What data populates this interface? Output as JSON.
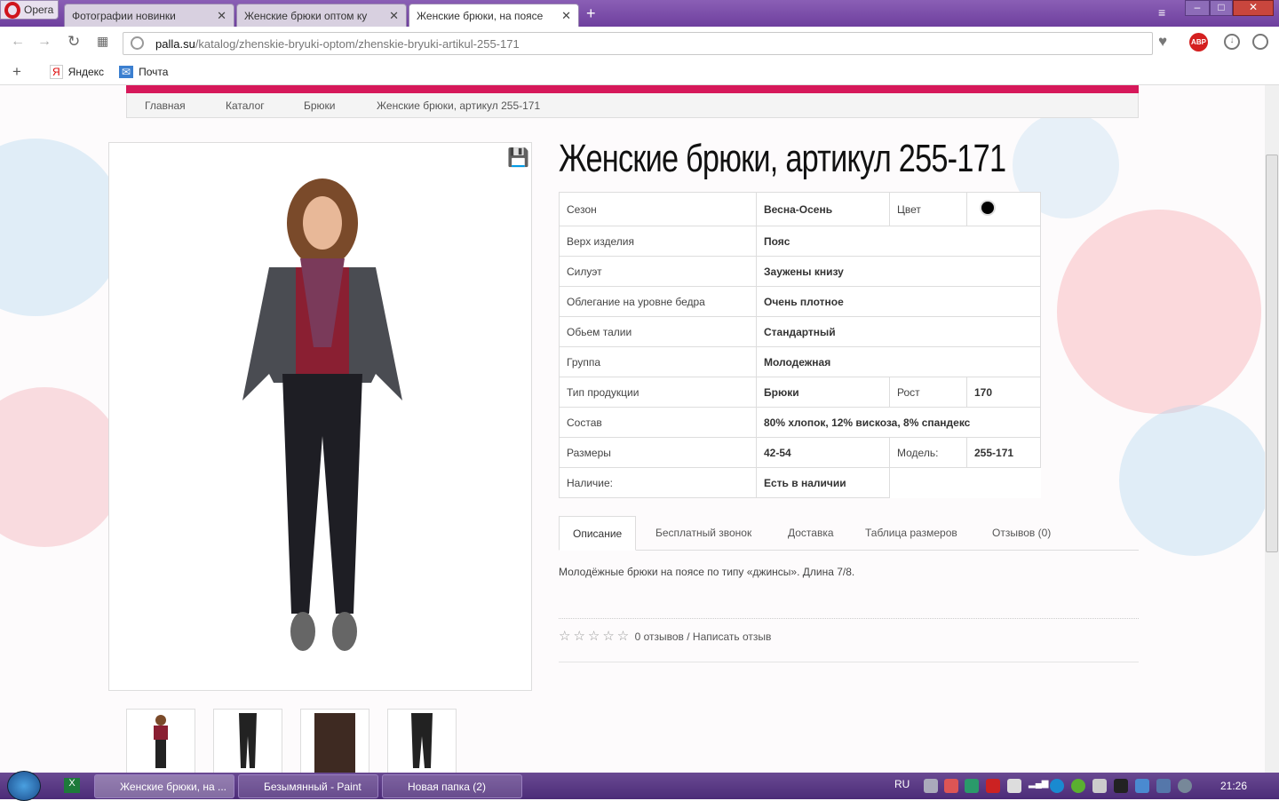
{
  "browser": {
    "opera_label": "Opera",
    "tabs": [
      {
        "label": "Фотографии новинки"
      },
      {
        "label": "Женские брюки оптом ку"
      },
      {
        "label": "Женские брюки, на поясе"
      }
    ],
    "url_host": "palla.su",
    "url_path": "/katalog/zhenskie-bryuki-optom/zhenskie-bryuki-artikul-255-171",
    "bookmarks": [
      {
        "label": "Яндекс"
      },
      {
        "label": "Почта"
      }
    ]
  },
  "breadcrumb": [
    "Главная",
    "Каталог",
    "Брюки",
    "Женские брюки, артикул 255-171"
  ],
  "product": {
    "title": "Женские брюки, артикул 255-171",
    "specs": [
      {
        "label": "Сезон",
        "value": "Весна-Осень",
        "label2": "Цвет",
        "color": "#000000"
      },
      {
        "label": "Верх изделия",
        "value": "Пояс"
      },
      {
        "label": "Силуэт",
        "value": "Заужены книзу"
      },
      {
        "label": "Облегание на уровне бедра",
        "value": "Очень плотное"
      },
      {
        "label": "Обьем талии",
        "value": "Стандартный"
      },
      {
        "label": "Группа",
        "value": "Молодежная"
      },
      {
        "label": "Тип продукции",
        "value": "Брюки",
        "label2": "Рост",
        "value2": "170"
      },
      {
        "label": "Состав",
        "value": "80% хлопок, 12% вискоза, 8% спандекс"
      },
      {
        "label": "Размеры",
        "value": "42-54",
        "label2": "Модель:",
        "value2": "255-171"
      },
      {
        "label": "Наличие:",
        "value": "Есть в наличии"
      }
    ],
    "tabs": [
      "Описание",
      "Бесплатный звонок",
      "Доставка",
      "Таблица размеров",
      "Отзывов (0)"
    ],
    "description": "Молодёжные брюки на поясе по типу «джинсы». Длина 7/8.",
    "rating": 0,
    "reviews_text": "0 отзывов / Написать отзыв"
  },
  "taskbar": {
    "tasks": [
      "Женские брюки, на ...",
      "Безымянный - Paint",
      "Новая папка (2)"
    ],
    "lang": "RU",
    "clock": "21:26"
  }
}
